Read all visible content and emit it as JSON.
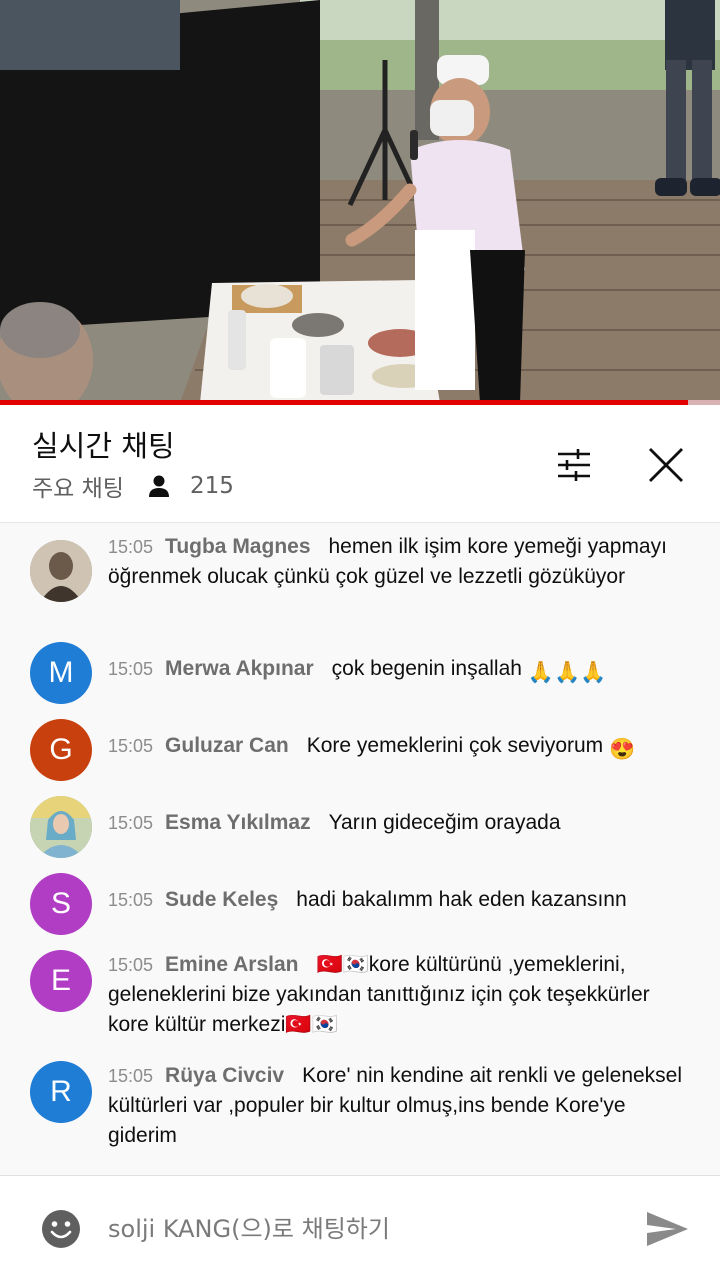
{
  "video": {
    "progress": 0.955,
    "colors": {
      "progress": "#e00000"
    }
  },
  "header": {
    "title": "실시간 채팅",
    "mode": "주요 채팅",
    "viewer_count": "215",
    "icons": {
      "viewers": "person-icon",
      "filter": "sliders-icon",
      "close": "close-icon"
    }
  },
  "messages": [
    {
      "time": "15:05",
      "author": "Tugba Magnes",
      "text": "hemen ilk işim kore yemeği yapmayı öğrenmek olucak çünkü çok güzel ve lezzetli gözüküyor",
      "avatar": {
        "type": "photo",
        "color": "#8a7a66"
      }
    },
    {
      "time": "15:05",
      "author": "Merwa Akpınar",
      "text": "çok begenin inşallah",
      "emoji": "🙏🙏🙏",
      "avatar": {
        "type": "letter",
        "letter": "M",
        "color": "#1f7dd6"
      }
    },
    {
      "time": "15:05",
      "author": "Guluzar Can",
      "text": "Kore yemeklerini çok seviyorum",
      "emoji": "😍",
      "avatar": {
        "type": "letter",
        "letter": "G",
        "color": "#c9400f"
      }
    },
    {
      "time": "15:05",
      "author": "Esma Yıkılmaz",
      "text": "Yarın gideceğim orayada",
      "avatar": {
        "type": "photo",
        "color": "#7a8f6a"
      }
    },
    {
      "time": "15:05",
      "author": "Sude Keleş",
      "text": "hadi bakalımm hak eden kazansınn",
      "avatar": {
        "type": "letter",
        "letter": "S",
        "color": "#b03dc4"
      }
    },
    {
      "time": "15:05",
      "author": "Emine Arslan",
      "text": "🇹🇷🇰🇷kore kültürünü ,yemeklerini, geleneklerini bize yakından tanıttığınız için çok teşekkürler kore kültür merkezi🇹🇷🇰🇷",
      "avatar": {
        "type": "letter",
        "letter": "E",
        "color": "#b03dc4"
      }
    },
    {
      "time": "15:05",
      "author": "Rüya Civciv",
      "text": "Kore' nin kendine ait renkli ve geleneksel kültürleri var ,populer bir kultur olmuş,ins bende Kore'ye giderim",
      "avatar": {
        "type": "letter",
        "letter": "R",
        "color": "#1f7dd6"
      }
    }
  ],
  "input": {
    "placeholder": "solji KANG(으)로 채팅하기",
    "icons": {
      "emoji": "smiley-icon",
      "send": "send-icon"
    }
  }
}
